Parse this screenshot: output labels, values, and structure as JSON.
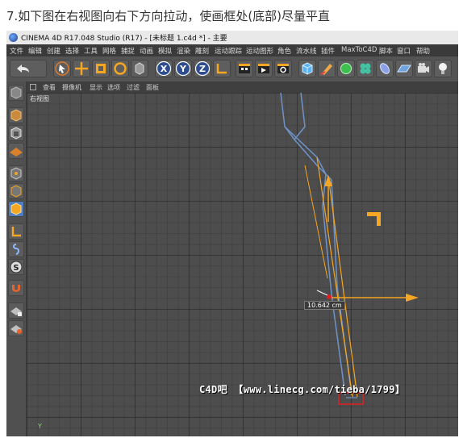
{
  "caption": "7.如下图在右视图向右下方向拉动，使画框处(底部)尽量平直",
  "window": {
    "title": "CINEMA 4D R17.048 Studio (R17) - [未标题 1.c4d *] - 主要"
  },
  "menu": [
    "文件",
    "编辑",
    "创建",
    "选择",
    "工具",
    "网格",
    "捕捉",
    "动画",
    "模拟",
    "渲染",
    "雕刻",
    "运动跟踪",
    "运动图形",
    "角色",
    "流水线",
    "插件",
    "MaxToC4D",
    "脚本",
    "窗口",
    "帮助"
  ],
  "viewport": {
    "menu": [
      "查看",
      "摄像机",
      "显示",
      "选项",
      "过滤",
      "面板"
    ],
    "name": "右视图",
    "measurement": "10.642 cm",
    "axis_label": "Y"
  },
  "toolbar_icons": [
    "undo-icon",
    "redo-icon",
    "select-arrow-icon",
    "move-icon",
    "scale-icon",
    "rotate-icon",
    "object-mode-icon",
    "x-axis-icon",
    "y-axis-icon",
    "z-axis-icon",
    "coordinate-system-icon",
    "render-view-icon",
    "render-picture-viewer-icon",
    "render-settings-icon",
    "cube-icon",
    "pen-icon",
    "subdivision-icon",
    "cloner-icon",
    "deformer-icon",
    "floor-icon",
    "camera-icon",
    "light-icon"
  ],
  "watermark": "C4D吧 【www.linecg.com/tieba/1799】",
  "colors": {
    "accent_orange": "#f5a623",
    "spline_blue": "#6f93c8",
    "highlight_red": "#e02020",
    "viewport_bg": "#4d4d4d"
  }
}
